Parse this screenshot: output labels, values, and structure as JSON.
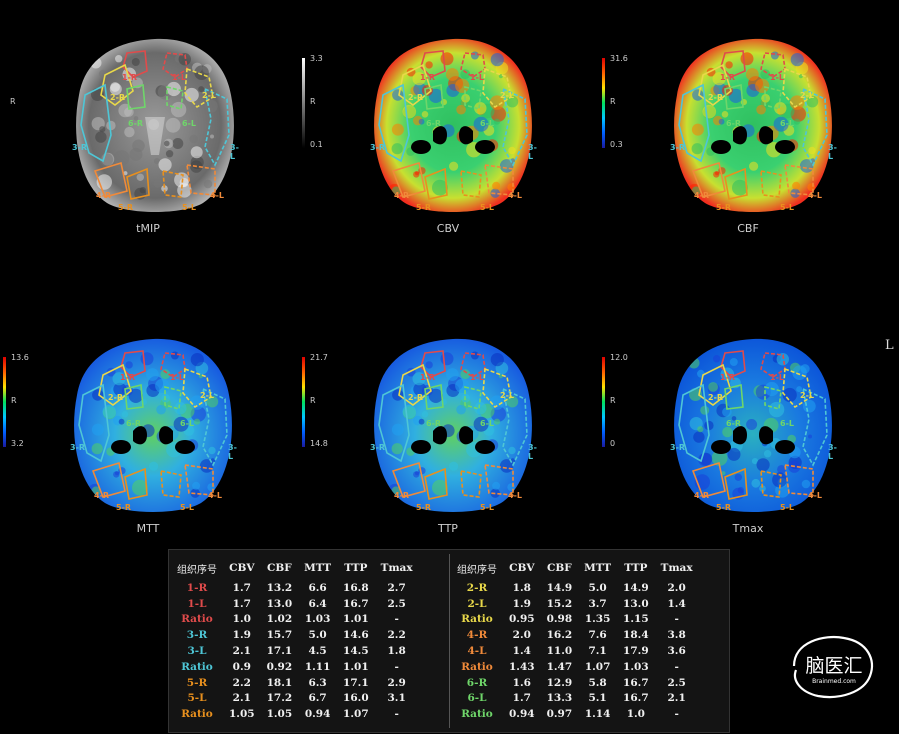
{
  "colors": {
    "group1": "#e04b4b",
    "group2": "#e8d84a",
    "group3": "#4ec6d6",
    "group4": "#f08a3a",
    "group5": "#e8901e",
    "group6": "#6fd66a"
  },
  "side_labels": {
    "right": "R",
    "left": "L"
  },
  "panels": [
    {
      "id": "tmip",
      "label": "tMIP",
      "scale": "gray",
      "max": "3.3",
      "mid": "R",
      "min": "0.1"
    },
    {
      "id": "cbv",
      "label": "CBV",
      "scale": "rainbow",
      "max": "31.6",
      "mid": "R",
      "min": "0.3"
    },
    {
      "id": "cbf",
      "label": "CBF",
      "scale": "rainbow",
      "max": "",
      "mid": "",
      "min": ""
    },
    {
      "id": "mtt",
      "label": "MTT",
      "scale": "rainbow",
      "max": "13.6",
      "mid": "R",
      "min": "3.2"
    },
    {
      "id": "ttp",
      "label": "TTP",
      "scale": "rainbow",
      "max": "21.7",
      "mid": "R",
      "min": "14.8"
    },
    {
      "id": "tmax",
      "label": "Tmax",
      "scale": "rainbow",
      "max": "12.0",
      "mid": "R",
      "min": "0"
    }
  ],
  "region_tags": [
    "1-R",
    "1-L",
    "2-R",
    "2-L",
    "3-R",
    "3-L",
    "4-R",
    "4-L",
    "5-R",
    "5-L",
    "6-R",
    "6-L"
  ],
  "table": {
    "headers": [
      "组织序号",
      "CBV",
      "CBF",
      "MTT",
      "TTP",
      "Tmax"
    ],
    "left_rows": [
      {
        "name": "1-R",
        "color": "#e04b4b",
        "vals": [
          "1.7",
          "13.2",
          "6.6",
          "16.8",
          "2.7"
        ]
      },
      {
        "name": "1-L",
        "color": "#e04b4b",
        "vals": [
          "1.7",
          "13.0",
          "6.4",
          "16.7",
          "2.5"
        ]
      },
      {
        "name": "Ratio",
        "color": "#e04b4b",
        "vals": [
          "1.0",
          "1.02",
          "1.03",
          "1.01",
          "-"
        ]
      },
      {
        "name": "3-R",
        "color": "#4ec6d6",
        "vals": [
          "1.9",
          "15.7",
          "5.0",
          "14.6",
          "2.2"
        ]
      },
      {
        "name": "3-L",
        "color": "#4ec6d6",
        "vals": [
          "2.1",
          "17.1",
          "4.5",
          "14.5",
          "1.8"
        ]
      },
      {
        "name": "Ratio",
        "color": "#4ec6d6",
        "vals": [
          "0.9",
          "0.92",
          "1.11",
          "1.01",
          "-"
        ]
      },
      {
        "name": "5-R",
        "color": "#e8901e",
        "vals": [
          "2.2",
          "18.1",
          "6.3",
          "17.1",
          "2.9"
        ]
      },
      {
        "name": "5-L",
        "color": "#e8901e",
        "vals": [
          "2.1",
          "17.2",
          "6.7",
          "16.0",
          "3.1"
        ]
      },
      {
        "name": "Ratio",
        "color": "#e8901e",
        "vals": [
          "1.05",
          "1.05",
          "0.94",
          "1.07",
          "-"
        ]
      }
    ],
    "right_rows": [
      {
        "name": "2-R",
        "color": "#e8d84a",
        "vals": [
          "1.8",
          "14.9",
          "5.0",
          "14.9",
          "2.0"
        ]
      },
      {
        "name": "2-L",
        "color": "#e8d84a",
        "vals": [
          "1.9",
          "15.2",
          "3.7",
          "13.0",
          "1.4"
        ]
      },
      {
        "name": "Ratio",
        "color": "#e8d84a",
        "vals": [
          "0.95",
          "0.98",
          "1.35",
          "1.15",
          "-"
        ]
      },
      {
        "name": "4-R",
        "color": "#f08a3a",
        "vals": [
          "2.0",
          "16.2",
          "7.6",
          "18.4",
          "3.8"
        ]
      },
      {
        "name": "4-L",
        "color": "#f08a3a",
        "vals": [
          "1.4",
          "11.0",
          "7.1",
          "17.9",
          "3.6"
        ]
      },
      {
        "name": "Ratio",
        "color": "#f08a3a",
        "vals": [
          "1.43",
          "1.47",
          "1.07",
          "1.03",
          "-"
        ]
      },
      {
        "name": "6-R",
        "color": "#6fd66a",
        "vals": [
          "1.6",
          "12.9",
          "5.8",
          "16.7",
          "2.5"
        ]
      },
      {
        "name": "6-L",
        "color": "#6fd66a",
        "vals": [
          "1.7",
          "13.3",
          "5.1",
          "16.7",
          "2.1"
        ]
      },
      {
        "name": "Ratio",
        "color": "#6fd66a",
        "vals": [
          "0.94",
          "0.97",
          "1.14",
          "1.0",
          "-"
        ]
      }
    ]
  },
  "logo": {
    "main": "脑医汇",
    "sub": "Brainmed.com"
  }
}
